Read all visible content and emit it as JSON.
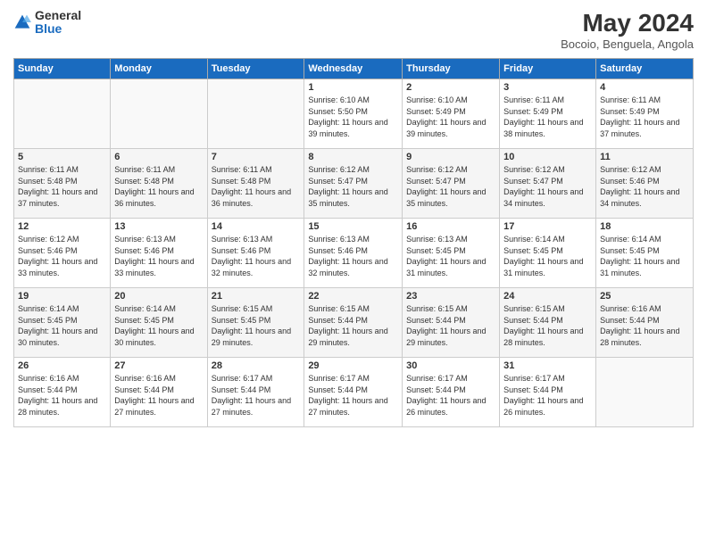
{
  "logo": {
    "general": "General",
    "blue": "Blue"
  },
  "header": {
    "title": "May 2024",
    "subtitle": "Bocoio, Benguela, Angola"
  },
  "weekdays": [
    "Sunday",
    "Monday",
    "Tuesday",
    "Wednesday",
    "Thursday",
    "Friday",
    "Saturday"
  ],
  "weeks": [
    [
      {
        "day": "",
        "sunrise": "",
        "sunset": "",
        "daylight": ""
      },
      {
        "day": "",
        "sunrise": "",
        "sunset": "",
        "daylight": ""
      },
      {
        "day": "",
        "sunrise": "",
        "sunset": "",
        "daylight": ""
      },
      {
        "day": "1",
        "sunrise": "Sunrise: 6:10 AM",
        "sunset": "Sunset: 5:50 PM",
        "daylight": "Daylight: 11 hours and 39 minutes."
      },
      {
        "day": "2",
        "sunrise": "Sunrise: 6:10 AM",
        "sunset": "Sunset: 5:49 PM",
        "daylight": "Daylight: 11 hours and 39 minutes."
      },
      {
        "day": "3",
        "sunrise": "Sunrise: 6:11 AM",
        "sunset": "Sunset: 5:49 PM",
        "daylight": "Daylight: 11 hours and 38 minutes."
      },
      {
        "day": "4",
        "sunrise": "Sunrise: 6:11 AM",
        "sunset": "Sunset: 5:49 PM",
        "daylight": "Daylight: 11 hours and 37 minutes."
      }
    ],
    [
      {
        "day": "5",
        "sunrise": "Sunrise: 6:11 AM",
        "sunset": "Sunset: 5:48 PM",
        "daylight": "Daylight: 11 hours and 37 minutes."
      },
      {
        "day": "6",
        "sunrise": "Sunrise: 6:11 AM",
        "sunset": "Sunset: 5:48 PM",
        "daylight": "Daylight: 11 hours and 36 minutes."
      },
      {
        "day": "7",
        "sunrise": "Sunrise: 6:11 AM",
        "sunset": "Sunset: 5:48 PM",
        "daylight": "Daylight: 11 hours and 36 minutes."
      },
      {
        "day": "8",
        "sunrise": "Sunrise: 6:12 AM",
        "sunset": "Sunset: 5:47 PM",
        "daylight": "Daylight: 11 hours and 35 minutes."
      },
      {
        "day": "9",
        "sunrise": "Sunrise: 6:12 AM",
        "sunset": "Sunset: 5:47 PM",
        "daylight": "Daylight: 11 hours and 35 minutes."
      },
      {
        "day": "10",
        "sunrise": "Sunrise: 6:12 AM",
        "sunset": "Sunset: 5:47 PM",
        "daylight": "Daylight: 11 hours and 34 minutes."
      },
      {
        "day": "11",
        "sunrise": "Sunrise: 6:12 AM",
        "sunset": "Sunset: 5:46 PM",
        "daylight": "Daylight: 11 hours and 34 minutes."
      }
    ],
    [
      {
        "day": "12",
        "sunrise": "Sunrise: 6:12 AM",
        "sunset": "Sunset: 5:46 PM",
        "daylight": "Daylight: 11 hours and 33 minutes."
      },
      {
        "day": "13",
        "sunrise": "Sunrise: 6:13 AM",
        "sunset": "Sunset: 5:46 PM",
        "daylight": "Daylight: 11 hours and 33 minutes."
      },
      {
        "day": "14",
        "sunrise": "Sunrise: 6:13 AM",
        "sunset": "Sunset: 5:46 PM",
        "daylight": "Daylight: 11 hours and 32 minutes."
      },
      {
        "day": "15",
        "sunrise": "Sunrise: 6:13 AM",
        "sunset": "Sunset: 5:46 PM",
        "daylight": "Daylight: 11 hours and 32 minutes."
      },
      {
        "day": "16",
        "sunrise": "Sunrise: 6:13 AM",
        "sunset": "Sunset: 5:45 PM",
        "daylight": "Daylight: 11 hours and 31 minutes."
      },
      {
        "day": "17",
        "sunrise": "Sunrise: 6:14 AM",
        "sunset": "Sunset: 5:45 PM",
        "daylight": "Daylight: 11 hours and 31 minutes."
      },
      {
        "day": "18",
        "sunrise": "Sunrise: 6:14 AM",
        "sunset": "Sunset: 5:45 PM",
        "daylight": "Daylight: 11 hours and 31 minutes."
      }
    ],
    [
      {
        "day": "19",
        "sunrise": "Sunrise: 6:14 AM",
        "sunset": "Sunset: 5:45 PM",
        "daylight": "Daylight: 11 hours and 30 minutes."
      },
      {
        "day": "20",
        "sunrise": "Sunrise: 6:14 AM",
        "sunset": "Sunset: 5:45 PM",
        "daylight": "Daylight: 11 hours and 30 minutes."
      },
      {
        "day": "21",
        "sunrise": "Sunrise: 6:15 AM",
        "sunset": "Sunset: 5:45 PM",
        "daylight": "Daylight: 11 hours and 29 minutes."
      },
      {
        "day": "22",
        "sunrise": "Sunrise: 6:15 AM",
        "sunset": "Sunset: 5:44 PM",
        "daylight": "Daylight: 11 hours and 29 minutes."
      },
      {
        "day": "23",
        "sunrise": "Sunrise: 6:15 AM",
        "sunset": "Sunset: 5:44 PM",
        "daylight": "Daylight: 11 hours and 29 minutes."
      },
      {
        "day": "24",
        "sunrise": "Sunrise: 6:15 AM",
        "sunset": "Sunset: 5:44 PM",
        "daylight": "Daylight: 11 hours and 28 minutes."
      },
      {
        "day": "25",
        "sunrise": "Sunrise: 6:16 AM",
        "sunset": "Sunset: 5:44 PM",
        "daylight": "Daylight: 11 hours and 28 minutes."
      }
    ],
    [
      {
        "day": "26",
        "sunrise": "Sunrise: 6:16 AM",
        "sunset": "Sunset: 5:44 PM",
        "daylight": "Daylight: 11 hours and 28 minutes."
      },
      {
        "day": "27",
        "sunrise": "Sunrise: 6:16 AM",
        "sunset": "Sunset: 5:44 PM",
        "daylight": "Daylight: 11 hours and 27 minutes."
      },
      {
        "day": "28",
        "sunrise": "Sunrise: 6:17 AM",
        "sunset": "Sunset: 5:44 PM",
        "daylight": "Daylight: 11 hours and 27 minutes."
      },
      {
        "day": "29",
        "sunrise": "Sunrise: 6:17 AM",
        "sunset": "Sunset: 5:44 PM",
        "daylight": "Daylight: 11 hours and 27 minutes."
      },
      {
        "day": "30",
        "sunrise": "Sunrise: 6:17 AM",
        "sunset": "Sunset: 5:44 PM",
        "daylight": "Daylight: 11 hours and 26 minutes."
      },
      {
        "day": "31",
        "sunrise": "Sunrise: 6:17 AM",
        "sunset": "Sunset: 5:44 PM",
        "daylight": "Daylight: 11 hours and 26 minutes."
      },
      {
        "day": "",
        "sunrise": "",
        "sunset": "",
        "daylight": ""
      }
    ]
  ]
}
